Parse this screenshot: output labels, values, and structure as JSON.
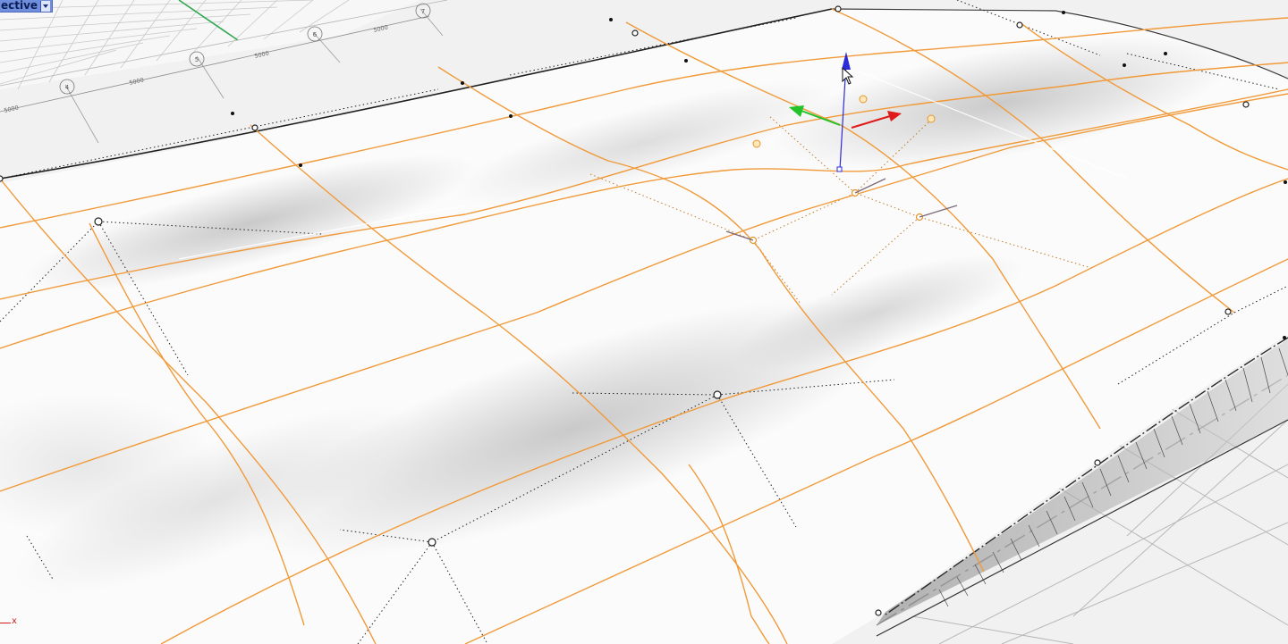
{
  "viewport": {
    "label": "ective",
    "dropdown_icon": "chevron-down-icon",
    "axis_x_label": "x"
  },
  "grid_labels": {
    "numbers": [
      "4",
      "5",
      "6",
      "7"
    ],
    "dims": [
      "5000",
      "5000",
      "5000",
      "5000"
    ]
  },
  "colors": {
    "curve": "#f09a3a",
    "gumball_x": "#e01919",
    "gumball_y": "#23c42a",
    "gumball_z": "#2b2bd8",
    "grid_green": "#2fa84f",
    "tab_blue": "#6f8fdd"
  }
}
